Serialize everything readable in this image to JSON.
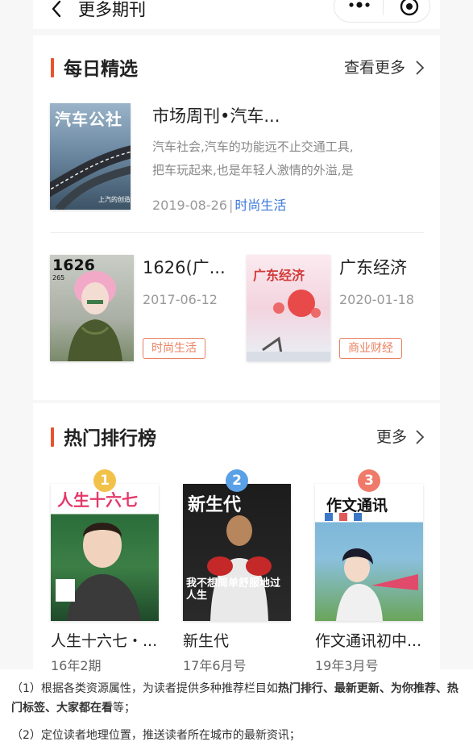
{
  "topbar": {
    "title": "更多期刊"
  },
  "daily": {
    "title": "每日精选",
    "more": "查看更多",
    "featured": {
      "cover_text": "汽车公社",
      "cover_subtext": "上汽的创造",
      "title": "市场周刊•汽车...",
      "desc_line1": "汽车社会,汽车的功能远不止交通工具,",
      "desc_line2": "把车玩起来,也是年轻人激情的外溢,是",
      "date": "2019-08-26",
      "category": "时尚生活"
    },
    "items": [
      {
        "cover_text": "1626",
        "cover_sub": "265",
        "title": "1626(广...",
        "date": "2017-06-12",
        "tag": "时尚生活"
      },
      {
        "cover_text": "广东经济",
        "title": "广东经济",
        "date": "2020-01-18",
        "tag": "商业财经"
      }
    ]
  },
  "hot": {
    "title": "热门排行榜",
    "more": "更多",
    "items": [
      {
        "rank": "1",
        "cover_text": "人生十六七",
        "title": "人生十六七・...",
        "issue": "16年2期",
        "badge_color": "#f2c14a"
      },
      {
        "rank": "2",
        "cover_text": "新生代",
        "cover_sub": "我不想简单舒服地过人生",
        "title": "新生代",
        "issue": "17年6月号",
        "badge_color": "#5aa0e6"
      },
      {
        "rank": "3",
        "cover_text": "作文通讯",
        "title": "作文通讯初中...",
        "issue": "19年3月号",
        "badge_color": "#ef7a6a"
      }
    ]
  },
  "notes": {
    "n1_prefix": "（1）根据各类资源属性，为读者提供多种推荐栏目如",
    "n1_bold": "热门排行、最新更新、为你推荐、热门标签、大家都在看",
    "n1_suffix": "等；",
    "n2": "（2）定位读者地理位置，推送读者所在城市的最新资讯；"
  },
  "colors": {
    "accent": "#e8542e",
    "link": "#3a78d8",
    "tag": "#e9815f"
  }
}
